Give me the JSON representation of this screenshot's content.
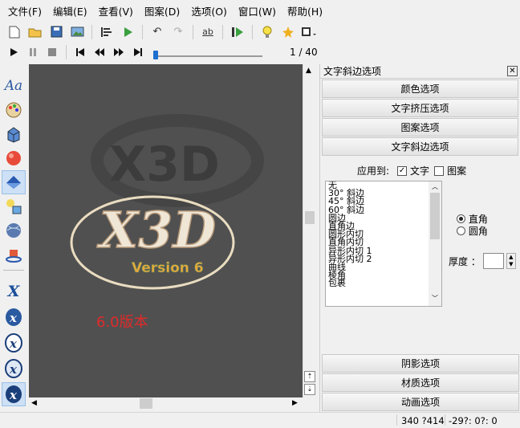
{
  "menu": [
    "文件(F)",
    "编辑(E)",
    "查看(V)",
    "图案(D)",
    "选项(O)",
    "窗口(W)",
    "帮助(H)"
  ],
  "player": {
    "frame_counter": "1 / 40",
    "progress": 0.0
  },
  "viewport": {
    "logo_text": "X3D",
    "version_text": "Version 6",
    "caption": "6.0版本",
    "background": "#505050",
    "caption_color": "#e02a2a"
  },
  "panel": {
    "title": "文字斜边选项",
    "close": "✕",
    "sections_top": [
      "颜色选项",
      "文字挤压选项",
      "图案选项",
      "文字斜边选项"
    ],
    "apply_label": "应用到:",
    "apply_text": "文字",
    "apply_pattern": "图案",
    "bevel_list": [
      "无",
      "30° 斜边",
      "45° 斜边",
      "60° 斜边",
      "圆边",
      "直角边",
      "圆形内切",
      "直角内切",
      "异形内切 1",
      "异形内切 2",
      "曲线",
      "棱角",
      "包裹"
    ],
    "corner_square": "直角",
    "corner_round": "圆角",
    "thickness_label": "厚度 ：",
    "sections_bottom": [
      "阴影选项",
      "材质选项",
      "动画选项"
    ]
  },
  "status": {
    "coords": "340 ?414",
    "angles": "-29?: 0?: 0"
  }
}
